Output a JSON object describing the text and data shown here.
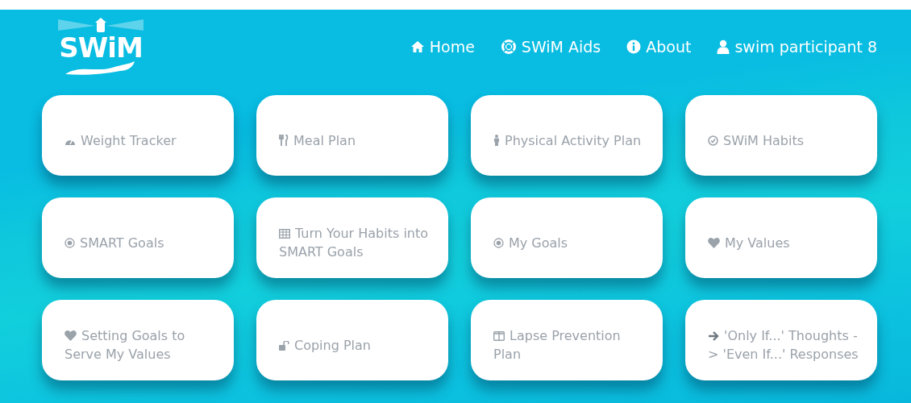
{
  "brand": {
    "logo_text": "SWiM"
  },
  "nav": [
    {
      "label": "Home"
    },
    {
      "label": "SWiM Aids"
    },
    {
      "label": "About"
    },
    {
      "label": "swim participant 8"
    }
  ],
  "tiles": [
    {
      "label": "Weight Tracker"
    },
    {
      "label": "Meal Plan"
    },
    {
      "label": "Physical Activity Plan"
    },
    {
      "label": "SWiM Habits"
    },
    {
      "label": "SMART Goals"
    },
    {
      "label": "Turn Your Habits into SMART Goals"
    },
    {
      "label": "My Goals"
    },
    {
      "label": "My Values"
    },
    {
      "label": "Setting Goals to Serve My Values"
    },
    {
      "label": "Coping Plan"
    },
    {
      "label": "Lapse Prevention Plan"
    },
    {
      "label": "'Only If...' Thoughts -> 'Even If...' Responses"
    }
  ]
}
